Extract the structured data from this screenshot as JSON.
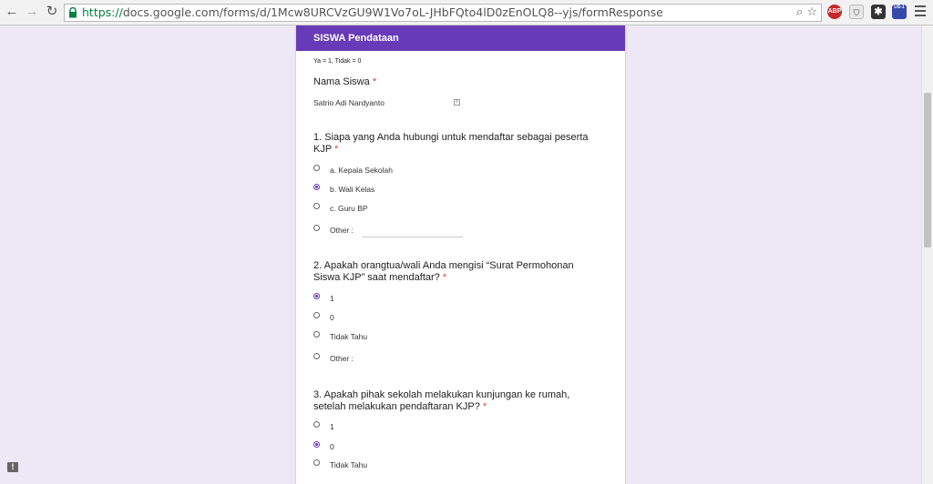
{
  "browser": {
    "url_scheme": "https://",
    "url_rest": "docs.google.com/forms/d/1Mcw8URCVzGU9W1Vo7oL-JHbFQto4lD0zEnOLQ8--yjs/formResponse",
    "ext_abp": "ABP",
    "ext_us": "US-1"
  },
  "form": {
    "header": "SISWA Pendataan",
    "hint": "Ya = 1, Tidak = 0",
    "name_question": {
      "title": "Nama Siswa",
      "required_mark": "*",
      "value": "Satrio Adi Nardyanto"
    },
    "q1": {
      "title_line1": "1. Siapa yang Anda hubungi untuk mendaftar sebagai peserta",
      "title_line2": "KJP",
      "required_mark": "*",
      "options": [
        "a. Kepala Sekolah",
        "b. Wali Kelas",
        "c. Guru BP",
        "Other :"
      ],
      "selected_index": 1
    },
    "q2": {
      "title_line1": "2. Apakah orangtua/wali Anda mengisi “Surat Permohonan",
      "title_line2": "Siswa KJP” saat mendaftar?",
      "required_mark": "*",
      "options": [
        "1",
        "0",
        "Tidak Tahu",
        "Other :"
      ],
      "selected_index": 0
    },
    "q3": {
      "title_line1": "3. Apakah pihak sekolah melakukan kunjungan ke rumah,",
      "title_line2": "setelah melakukan pendaftaran KJP?",
      "required_mark": "*",
      "options": [
        "1",
        "0",
        "Tidak Tahu"
      ],
      "selected_index": 1
    }
  }
}
